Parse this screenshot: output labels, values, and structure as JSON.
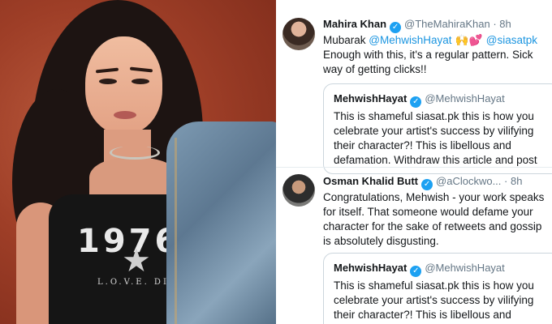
{
  "photo": {
    "shirt_text": "1976",
    "shirt_sub": "L.O.V.E. DIV"
  },
  "tweets": [
    {
      "name": "Mahira Khan",
      "handle": "@TheMahiraKhan",
      "time": "· 8h",
      "body_prefix": "Mubarak ",
      "mention1": "@MehwishHayat",
      "emojis": " 🙌💕 ",
      "mention2": "@siasatpk",
      "body_rest": "Enough with this, it's a regular pattern. Sick way of getting clicks!!",
      "quote": {
        "name": "MehwishHayat",
        "handle": "@MehwishHayat",
        "body": "This is shameful siasat.pk this is how you celebrate your artist's success by vilifying their character?! This is libellous and defamation. Withdraw this article and post"
      }
    },
    {
      "name": "Osman Khalid Butt",
      "handle": "@aClockwo...",
      "time": "· 8h",
      "body": "Congratulations, Mehwish - your work speaks for itself. That someone would defame your character for the sake of retweets and gossip is absolutely disgusting.",
      "quote": {
        "name": "MehwishHayat",
        "handle": "@MehwishHayat",
        "body": "This is shameful siasat.pk this is how you celebrate your artist's success by vilifying their character?! This is libellous and"
      }
    }
  ],
  "colors": {
    "link": "#1b95e0",
    "verified": "#1da1f2",
    "text": "#14171a",
    "muted": "#657786"
  }
}
